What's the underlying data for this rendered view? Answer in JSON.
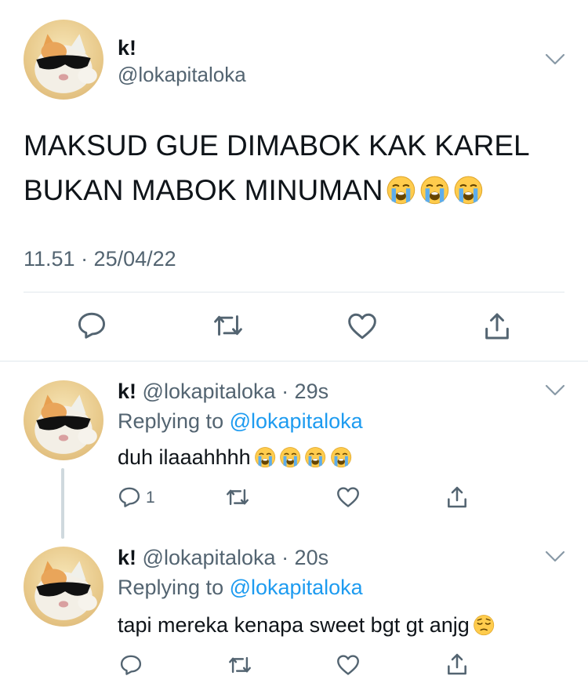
{
  "main_tweet": {
    "display_name": "k!",
    "handle": "@lokapitaloka",
    "text_line1": "MAKSUD GUE DIMABOK KAK KAREL",
    "text_line2": "BUKAN MABOK MINUMAN",
    "timestamp": "11.51 · 25/04/22",
    "actions": [
      "reply-icon",
      "retweet-icon",
      "like-icon",
      "share-icon"
    ]
  },
  "replies": [
    {
      "display_name": "k!",
      "handle": "@lokapitaloka",
      "time": "· 29s",
      "replying_prefix": "Replying to",
      "replying_to": "@lokapitaloka",
      "text": "duh ilaaahhhh",
      "reply_count": "1"
    },
    {
      "display_name": "k!",
      "handle": "@lokapitaloka",
      "time": "· 20s",
      "replying_prefix": "Replying to",
      "replying_to": "@lokapitaloka",
      "text": "tapi mereka kenapa sweet bgt gt anjg",
      "reply_count": ""
    }
  ],
  "colors": {
    "accent": "#1d9bf0",
    "muted": "#536471",
    "icon": "#536471",
    "divider": "#e1e8ed"
  }
}
